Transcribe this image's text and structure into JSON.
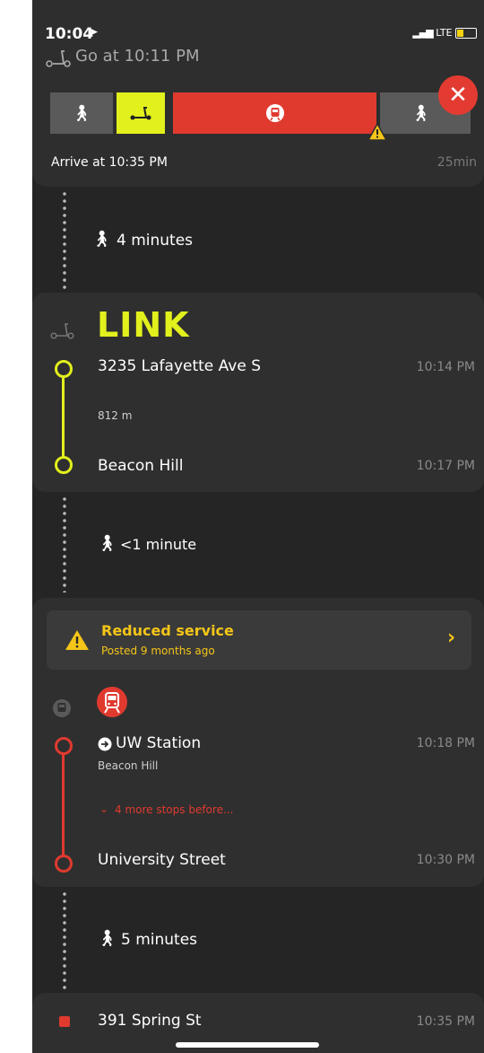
{
  "status_bar": {
    "time": "10:04",
    "network": "LTE"
  },
  "header": {
    "go_text": "Go at 10:11 PM",
    "arrive_text": "Arrive at 10:35 PM",
    "duration": "25min",
    "segments": [
      {
        "mode": "walk",
        "icon": "walk-icon"
      },
      {
        "mode": "scooter",
        "icon": "scooter-icon"
      },
      {
        "mode": "light-rail",
        "icon": "tram-icon"
      },
      {
        "mode": "walk",
        "icon": "walk-icon"
      }
    ],
    "close_icon": "close-icon"
  },
  "walk1": {
    "label": "4 minutes"
  },
  "scooter_leg": {
    "provider": "LINK",
    "from": "3235 Lafayette Ave S",
    "from_time": "10:14 PM",
    "distance": "812 m",
    "to": "Beacon Hill",
    "to_time": "10:17 PM",
    "line_color": "#e2f01c"
  },
  "walk2": {
    "label": "<1 minute"
  },
  "alert": {
    "title": "Reduced service",
    "subtitle": "Posted 9 months ago",
    "color": "#f5c518"
  },
  "rail_leg": {
    "from": "UW Station",
    "from_sub": "Beacon Hill",
    "from_time": "10:18 PM",
    "more_stops": "4 more stops before...",
    "to": "University Street",
    "to_time": "10:30 PM",
    "line_color": "#e03a2f"
  },
  "walk3": {
    "label": "5 minutes"
  },
  "destination": {
    "name": "391 Spring St",
    "time": "10:35 PM"
  }
}
